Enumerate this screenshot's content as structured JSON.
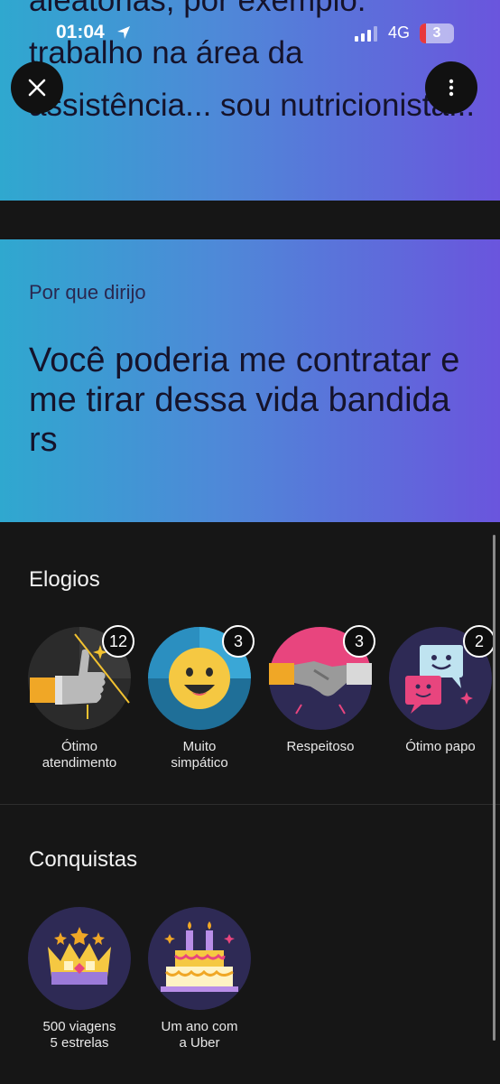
{
  "status_bar": {
    "time": "01:04",
    "network": "4G",
    "battery": "3"
  },
  "top_card": {
    "quote": "aleatórias, por exemplo: trabalho na área da assistência... sou nutricionista..."
  },
  "drive_reason": {
    "label": "Por que dirijo",
    "quote": "Você poderia me contratar e me tirar dessa vida bandida rs"
  },
  "praise": {
    "title": "Elogios",
    "items": [
      {
        "label": "Ótimo\natendimento",
        "count": "12",
        "icon": "thumbs-up-icon"
      },
      {
        "label": "Muito\nsimpático",
        "count": "3",
        "icon": "smiley-face-icon"
      },
      {
        "label": "Respeitoso",
        "count": "3",
        "icon": "handshake-icon"
      },
      {
        "label": "Ótimo papo",
        "count": "2",
        "icon": "chat-bubbles-icon"
      }
    ]
  },
  "achievements": {
    "title": "Conquistas",
    "items": [
      {
        "label": "500 viagens\n5 estrelas",
        "icon": "crown-icon"
      },
      {
        "label": "Um ano com\na Uber",
        "icon": "birthday-cake-icon"
      }
    ]
  },
  "colors": {
    "gradient_start": "#2fa8cf",
    "gradient_end": "#6a55dd",
    "background": "#161616"
  }
}
